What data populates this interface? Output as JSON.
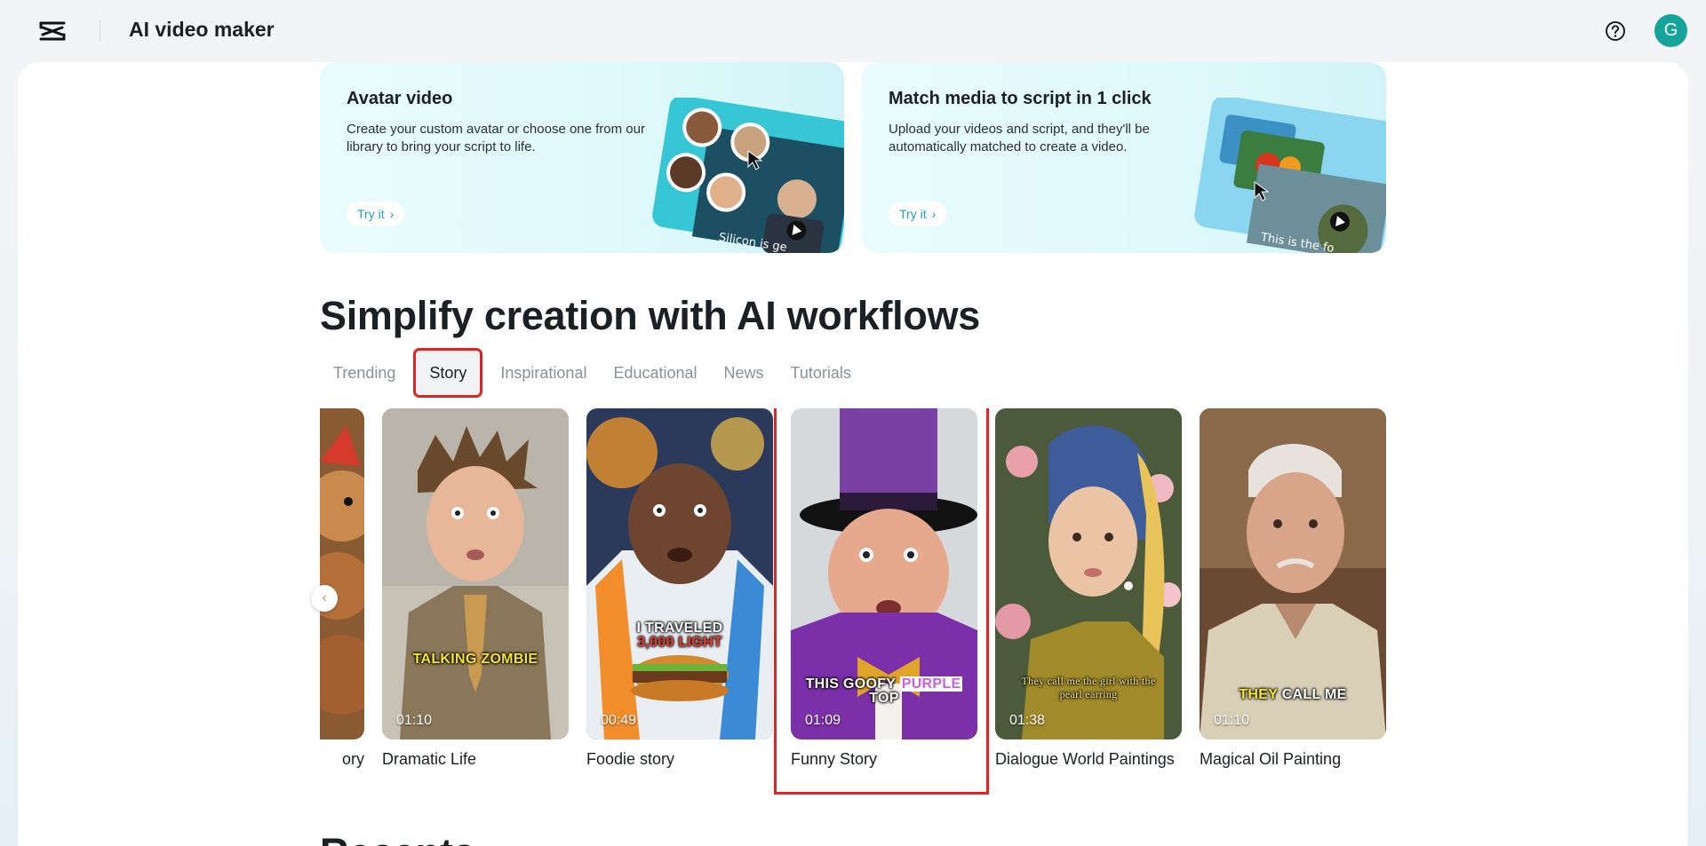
{
  "header": {
    "app_title": "AI video maker",
    "avatar_letter": "G"
  },
  "features": [
    {
      "title": "Avatar video",
      "description": "Create your custom avatar or choose one from our library to bring your script to life.",
      "button": "Try it",
      "art_caption": "Silicon is ge"
    },
    {
      "title": "Match media to script in 1 click",
      "description": "Upload your videos and script, and they'll be automatically matched to create a video.",
      "button": "Try it",
      "art_caption": "This is the fo"
    }
  ],
  "section": {
    "title": "Simplify creation with AI workflows",
    "tabs": [
      {
        "label": "Trending",
        "active": false
      },
      {
        "label": "Story",
        "active": true
      },
      {
        "label": "Inspirational",
        "active": false
      },
      {
        "label": "Educational",
        "active": false
      },
      {
        "label": "News",
        "active": false
      },
      {
        "label": "Tutorials",
        "active": false
      }
    ]
  },
  "cards": [
    {
      "title": "ory",
      "duration": "",
      "caption": ""
    },
    {
      "title": "Dramatic Life",
      "duration": "01:10",
      "caption_parts": [
        "TALKING ZOMBIE"
      ]
    },
    {
      "title": "Foodie story",
      "duration": "00:49",
      "caption_parts": [
        "I TRAVELED",
        "3,000 LIGHT"
      ]
    },
    {
      "title": "Funny Story",
      "duration": "01:09",
      "caption_parts": [
        "THIS GOOFY",
        "PURPLE",
        "TOP"
      ]
    },
    {
      "title": "Dialogue World Paintings",
      "duration": "01:38",
      "caption_parts": [
        "They call me the girl with the",
        "pearl earring"
      ]
    },
    {
      "title": "Magical Oil Painting",
      "duration": "01:10",
      "caption_parts": [
        "THEY",
        "CALL ME"
      ]
    }
  ],
  "recents_title": "Recents",
  "colors": {
    "accent": "#1aa3c6",
    "highlight": "#e52222",
    "avatar": "#15a39a"
  }
}
